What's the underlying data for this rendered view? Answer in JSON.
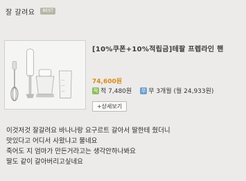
{
  "header": {
    "title": "잘 갈려요",
    "badge": "BEST"
  },
  "product": {
    "name": "[10%쿠폰+10%적립금]테팔 프렙라인 핸",
    "price": "74,600원",
    "points_icon_label": "적",
    "points": "적 7,480원",
    "installment_icon_label": "무",
    "installment": "무 3개월 (월 24,933원)",
    "detail_button_label": "+상세보기",
    "image_icon": "hand-blender-set-photo"
  },
  "comment": {
    "lines": [
      "이것저것 잘갈려요 바나나랑 요구르트 갈아서 딸한테 줬더니",
      "맛있다고 어디서 사왔냐고 물네요",
      "죽어도 지 엄마가 만든거라고는 생각안하나봐요",
      "딸도 같이 갈아버리고싶네요"
    ]
  },
  "colors": {
    "background": "#ecebea",
    "price": "#d88a1a",
    "points_icon": "#8fbf5a",
    "installment_icon": "#6f9fd0"
  }
}
